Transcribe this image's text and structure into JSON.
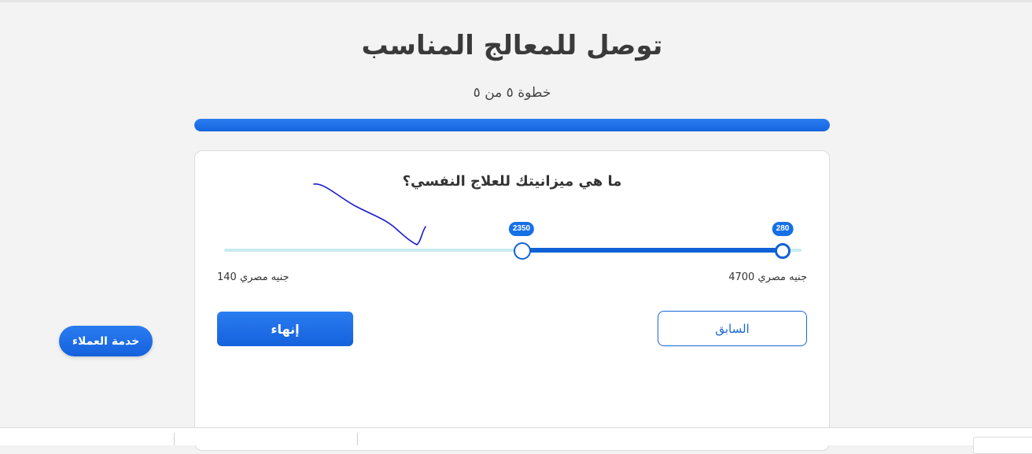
{
  "header": {
    "title": "توصل للمعالج المناسب",
    "step_text": "خطوة ٥ من ٥",
    "progress": 1.0
  },
  "question": {
    "text": "ما هي ميزانيتك للعلاج النفسي؟"
  },
  "budget_slider": {
    "min_label": "جنيه مصري 140",
    "max_label": "جنيه مصري 4700",
    "min": 140,
    "max": 4700,
    "lower_value": 280,
    "upper_value": 2350,
    "lower_bubble": "280",
    "upper_bubble": "2350"
  },
  "buttons": {
    "finish_label": "إنهاء",
    "previous_label": "السابق"
  },
  "support": {
    "label": "خدمة العملاء"
  },
  "colors": {
    "accent": "#1666e0",
    "track": "#c8ecf2",
    "annotation": "#1a1acc"
  }
}
